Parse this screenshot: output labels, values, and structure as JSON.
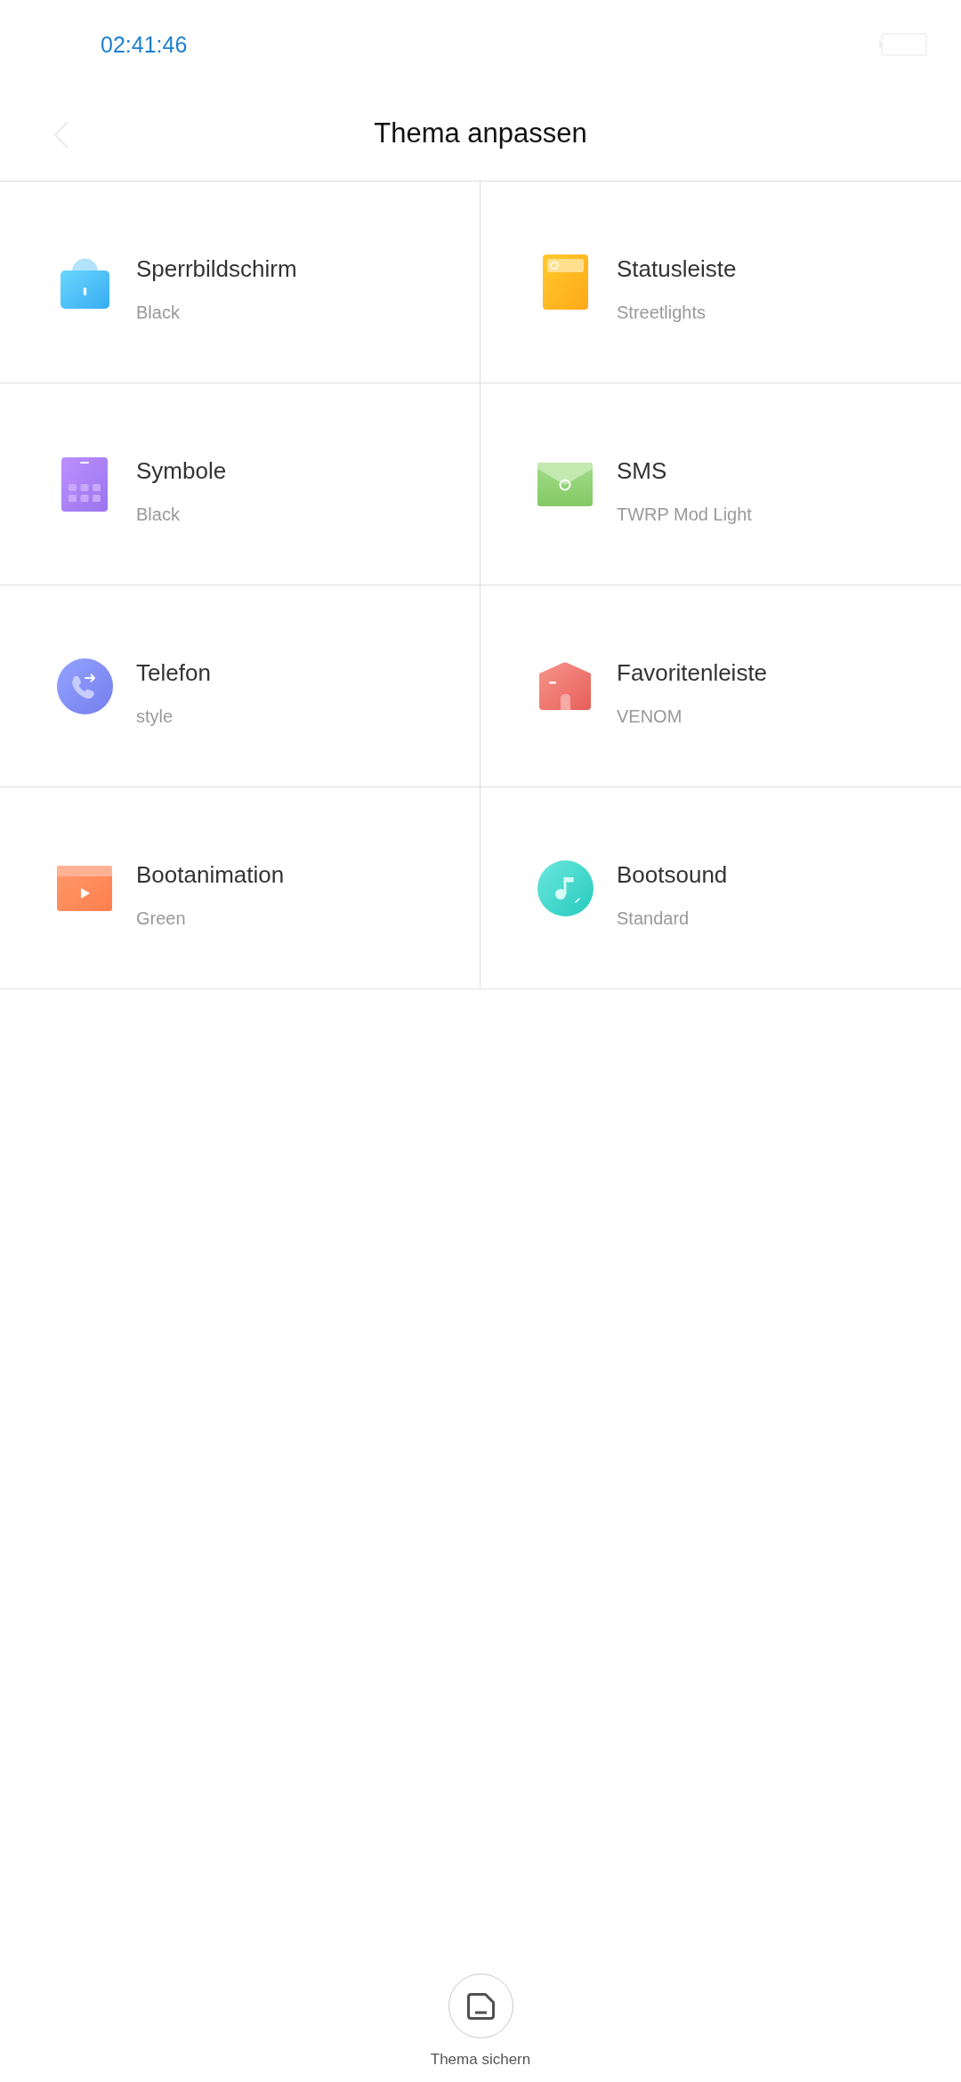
{
  "status_bar": {
    "time": "02:41:46"
  },
  "header": {
    "title": "Thema anpassen"
  },
  "options": [
    {
      "kind": "lockscreen",
      "title": "Sperrbildschirm",
      "value": "Black"
    },
    {
      "kind": "statusbar",
      "title": "Statusleiste",
      "value": "Streetlights"
    },
    {
      "kind": "icons",
      "title": "Symbole",
      "value": "Black"
    },
    {
      "kind": "sms",
      "title": "SMS",
      "value": "TWRP Mod Light"
    },
    {
      "kind": "phone",
      "title": "Telefon",
      "value": "style"
    },
    {
      "kind": "dock",
      "title": "Favoritenleiste",
      "value": "VENOM"
    },
    {
      "kind": "bootanimation",
      "title": "Bootanimation",
      "value": "Green"
    },
    {
      "kind": "bootsound",
      "title": "Bootsound",
      "value": "Standard"
    }
  ],
  "footer": {
    "save_label": "Thema sichern"
  }
}
